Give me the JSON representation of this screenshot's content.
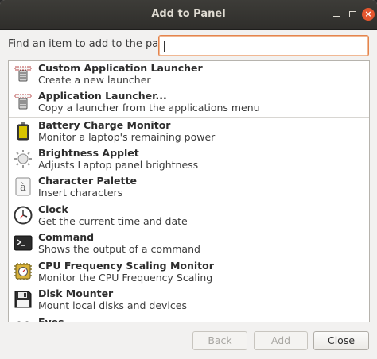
{
  "window": {
    "title": "Add to Panel",
    "controls": {
      "minimize": "–",
      "maximize": "□",
      "close": "×"
    }
  },
  "search": {
    "label": "Find an item to add to the panel:",
    "value": ""
  },
  "items": [
    {
      "name": "Custom Application Launcher",
      "desc": "Create a new launcher",
      "icon": "launcher-icon"
    },
    {
      "name": "Application Launcher...",
      "desc": "Copy a launcher from the applications menu",
      "icon": "launcher-icon"
    },
    {
      "name": "Battery Charge Monitor",
      "desc": "Monitor a laptop's remaining power",
      "icon": "battery-icon"
    },
    {
      "name": "Brightness Applet",
      "desc": "Adjusts Laptop panel brightness",
      "icon": "brightness-icon"
    },
    {
      "name": "Character Palette",
      "desc": "Insert characters",
      "icon": "character-palette-icon"
    },
    {
      "name": "Clock",
      "desc": "Get the current time and date",
      "icon": "clock-icon"
    },
    {
      "name": "Command",
      "desc": "Shows the output of a command",
      "icon": "terminal-icon"
    },
    {
      "name": "CPU Frequency Scaling Monitor",
      "desc": "Monitor the CPU Frequency Scaling",
      "icon": "cpu-icon"
    },
    {
      "name": "Disk Mounter",
      "desc": "Mount local disks and devices",
      "icon": "floppy-disk-icon"
    },
    {
      "name": "Eyes",
      "desc": "",
      "icon": "eyes-icon"
    }
  ],
  "buttons": {
    "back": "Back",
    "add": "Add",
    "close": "Close"
  }
}
